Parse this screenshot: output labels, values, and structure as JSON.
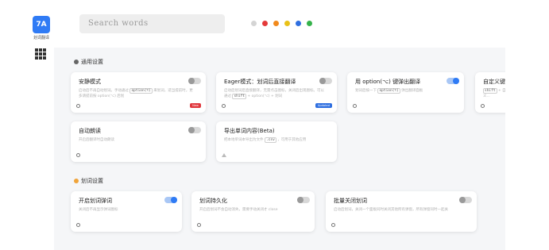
{
  "app": {
    "logo_text": "7A",
    "logo_label": "划词翻译"
  },
  "search": {
    "placeholder": "Search words"
  },
  "theme_colors": [
    "#d4d4d4",
    "#e43a3a",
    "#f18a1d",
    "#e9c117",
    "#2f6fe0",
    "#34b24a"
  ],
  "sections": {
    "general": {
      "title": "通用设置"
    },
    "word": {
      "title": "划词设置"
    }
  },
  "cards": {
    "quiet": {
      "title": "安静模式",
      "desc_1": "启动后不再自动划词。手动通过",
      "desc_code": "option(⌥)",
      "desc_2": "来划词，适当提前时，更多请提前按 option(⌥) 后划",
      "badge": "New"
    },
    "eager": {
      "title": "Eager模式：划词后直接翻译",
      "desc_1": "启动后划词后直接翻译，无需点击图标，关闭后出现图标。可以通过",
      "desc_code": "shift",
      "desc_2": "+ option(⌥) + 划词",
      "badge": "Updated"
    },
    "option_trigger": {
      "title": "用 option(⌥) 键弹出翻译",
      "desc_1": "划词后按一下",
      "desc_code": "option(⌥)",
      "desc_2": "弹出翻译面板"
    },
    "custom_key": {
      "title": "自定义键入",
      "desc_code": "shift",
      "desc_2": "+ 自定义..."
    },
    "auto_read": {
      "title": "自动朗读",
      "desc": "开启后翻译时自动朗读"
    },
    "export": {
      "title": "导出单词内容(Beta)",
      "desc_1": "把本地单词本导出为文件",
      "desc_code": ".csv",
      "desc_2": "，可用于其他应用"
    },
    "open_lookup": {
      "title": "开启划词弹词",
      "desc": "关闭后不再显示弹词图标"
    },
    "persist": {
      "title": "划词持久化",
      "desc": "开启后划词不会自动消失，需要手动关闭才 close"
    },
    "batch_close": {
      "title": "批量关闭划词",
      "desc": "启动后划词，关闭一个面板同时关闭其他所有弹窗，所有弹窗同时一起关"
    }
  },
  "toggles": {
    "quiet": "off",
    "eager": "off",
    "option_trigger": "on",
    "auto_read": "off",
    "open_lookup": "on",
    "persist": "off",
    "batch_close": "off"
  }
}
